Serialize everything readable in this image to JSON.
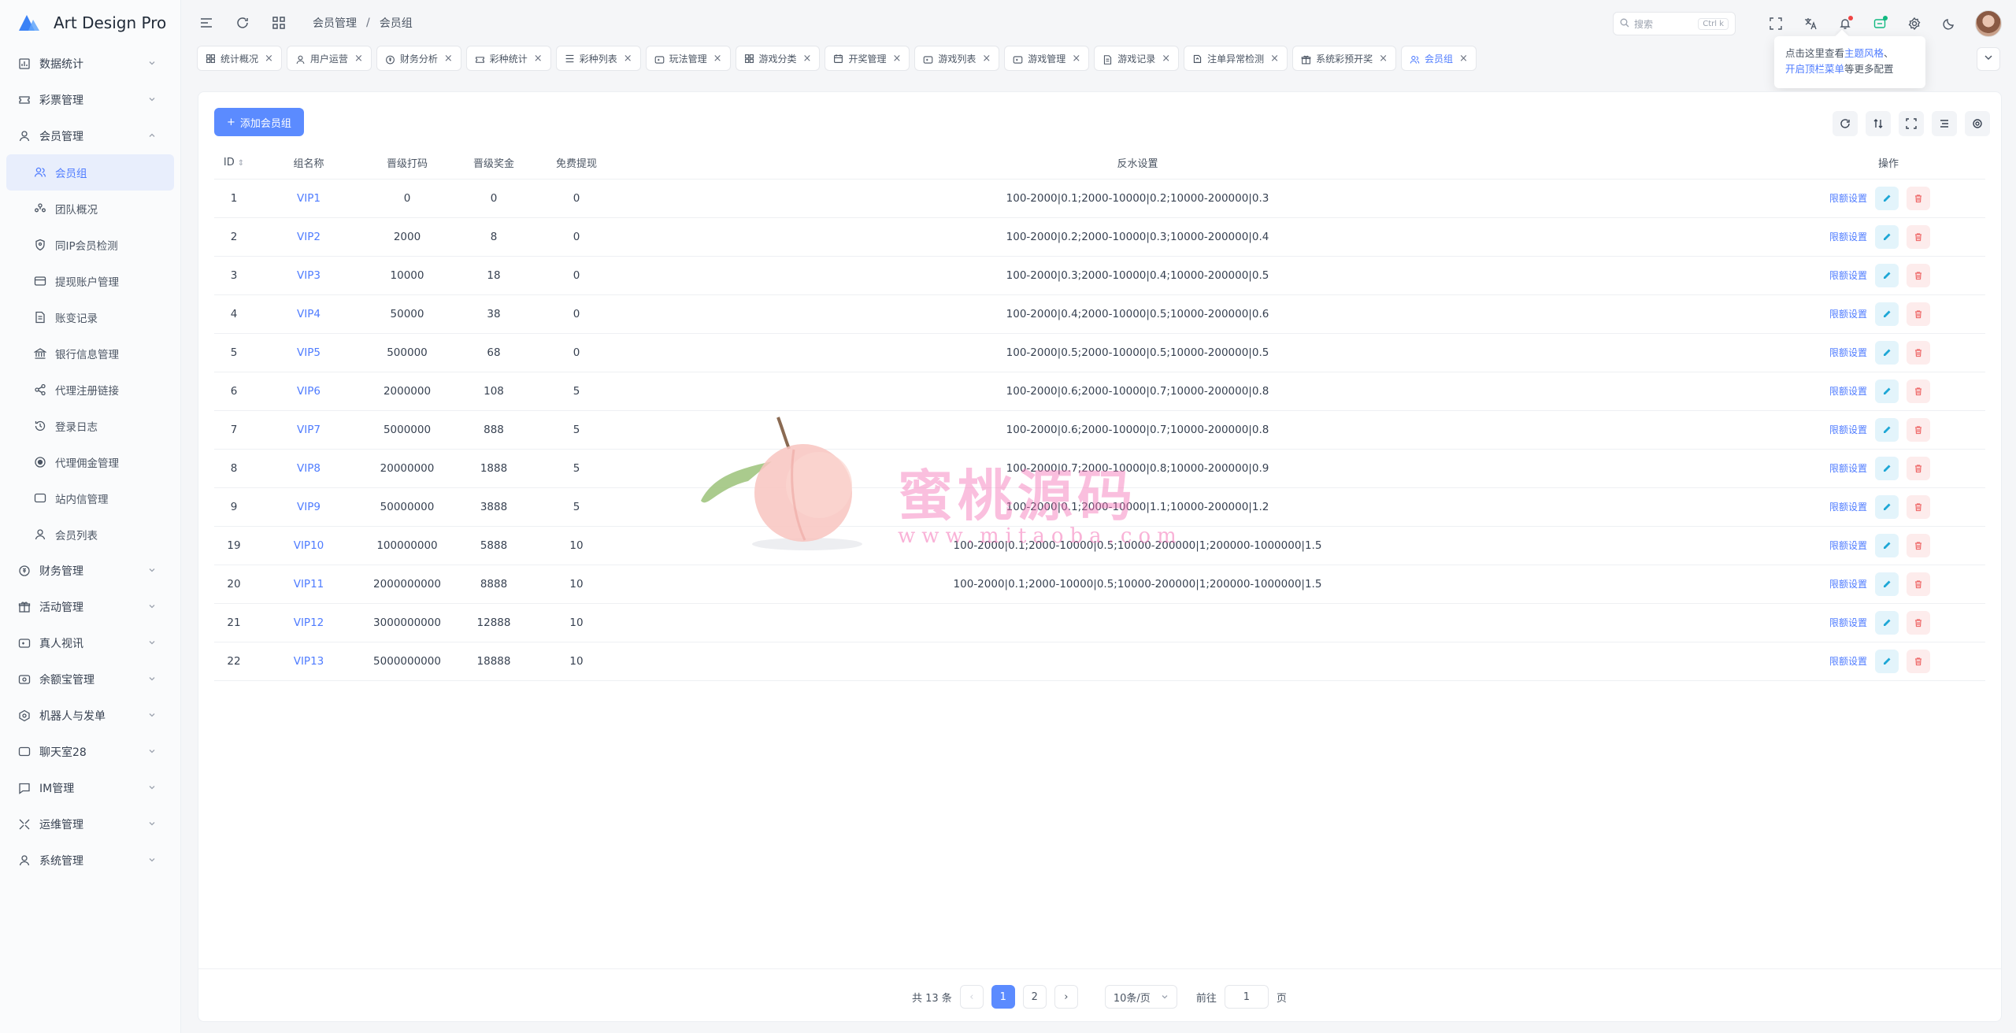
{
  "app": {
    "title": "Art Design Pro"
  },
  "sidebar": {
    "items": [
      {
        "label": "数据统计",
        "icon": "chart-icon"
      },
      {
        "label": "彩票管理",
        "icon": "ticket-icon"
      },
      {
        "label": "会员管理",
        "icon": "user-icon",
        "expanded": true,
        "children": [
          {
            "label": "会员组",
            "icon": "users-icon",
            "active": true
          },
          {
            "label": "团队概况",
            "icon": "team-icon"
          },
          {
            "label": "同IP会员检测",
            "icon": "shield-icon"
          },
          {
            "label": "提现账户管理",
            "icon": "card-icon"
          },
          {
            "label": "账变记录",
            "icon": "document-icon"
          },
          {
            "label": "银行信息管理",
            "icon": "bank-icon"
          },
          {
            "label": "代理注册链接",
            "icon": "share-icon"
          },
          {
            "label": "登录日志",
            "icon": "history-icon"
          },
          {
            "label": "代理佣金管理",
            "icon": "coin-icon"
          },
          {
            "label": "站内信管理",
            "icon": "message-icon"
          },
          {
            "label": "会员列表",
            "icon": "user-icon"
          }
        ]
      },
      {
        "label": "财务管理",
        "icon": "finance-icon"
      },
      {
        "label": "活动管理",
        "icon": "gift-icon"
      },
      {
        "label": "真人视讯",
        "icon": "video-icon"
      },
      {
        "label": "余额宝管理",
        "icon": "wallet-icon"
      },
      {
        "label": "机器人与发单",
        "icon": "robot-icon"
      },
      {
        "label": "聊天室28",
        "icon": "chat-icon"
      },
      {
        "label": "IM管理",
        "icon": "im-icon"
      },
      {
        "label": "运维管理",
        "icon": "tools-icon"
      },
      {
        "label": "系统管理",
        "icon": "user-icon"
      }
    ]
  },
  "topbar": {
    "breadcrumb": [
      "会员管理",
      "会员组"
    ],
    "breadcrumb_sep": "/",
    "search_placeholder": "搜索",
    "search_shortcut": "Ctrl k"
  },
  "tabs": [
    {
      "label": "统计概况",
      "icon": "grid-icon"
    },
    {
      "label": "用户运营",
      "icon": "user-icon"
    },
    {
      "label": "财务分析",
      "icon": "finance-icon"
    },
    {
      "label": "彩种统计",
      "icon": "ticket-icon"
    },
    {
      "label": "彩种列表",
      "icon": "list-icon"
    },
    {
      "label": "玩法管理",
      "icon": "video-icon"
    },
    {
      "label": "游戏分类",
      "icon": "grid-icon"
    },
    {
      "label": "开奖管理",
      "icon": "calendar-icon"
    },
    {
      "label": "游戏列表",
      "icon": "video-icon"
    },
    {
      "label": "游戏管理",
      "icon": "video-icon"
    },
    {
      "label": "游戏记录",
      "icon": "document-icon"
    },
    {
      "label": "注单异常检测",
      "icon": "alert-icon"
    },
    {
      "label": "系统彩预开奖",
      "icon": "gift-icon"
    },
    {
      "label": "会员组",
      "icon": "users-icon",
      "active": true
    }
  ],
  "tooltip": {
    "line1_prefix": "点击这里查看",
    "line1_link": "主题风格",
    "line1_suffix": "、",
    "line2_link": "开启顶栏菜单",
    "line2_suffix": "等更多配置"
  },
  "main": {
    "add_button": "添加会员组",
    "columns": [
      "ID",
      "组名称",
      "晋级打码",
      "晋级奖金",
      "免费提现",
      "反水设置",
      "操作"
    ],
    "op_link": "限额设置",
    "rows": [
      {
        "id": "1",
        "name": "VIP1",
        "bet": "0",
        "bonus": "0",
        "free": "0",
        "rebate": "100-2000|0.1;2000-10000|0.2;10000-200000|0.3"
      },
      {
        "id": "2",
        "name": "VIP2",
        "bet": "2000",
        "bonus": "8",
        "free": "0",
        "rebate": "100-2000|0.2;2000-10000|0.3;10000-200000|0.4"
      },
      {
        "id": "3",
        "name": "VIP3",
        "bet": "10000",
        "bonus": "18",
        "free": "0",
        "rebate": "100-2000|0.3;2000-10000|0.4;10000-200000|0.5"
      },
      {
        "id": "4",
        "name": "VIP4",
        "bet": "50000",
        "bonus": "38",
        "free": "0",
        "rebate": "100-2000|0.4;2000-10000|0.5;10000-200000|0.6"
      },
      {
        "id": "5",
        "name": "VIP5",
        "bet": "500000",
        "bonus": "68",
        "free": "0",
        "rebate": "100-2000|0.5;2000-10000|0.5;10000-200000|0.5"
      },
      {
        "id": "6",
        "name": "VIP6",
        "bet": "2000000",
        "bonus": "108",
        "free": "5",
        "rebate": "100-2000|0.6;2000-10000|0.7;10000-200000|0.8"
      },
      {
        "id": "7",
        "name": "VIP7",
        "bet": "5000000",
        "bonus": "888",
        "free": "5",
        "rebate": "100-2000|0.6;2000-10000|0.7;10000-200000|0.8"
      },
      {
        "id": "8",
        "name": "VIP8",
        "bet": "20000000",
        "bonus": "1888",
        "free": "5",
        "rebate": "100-2000|0.7;2000-10000|0.8;10000-200000|0.9"
      },
      {
        "id": "9",
        "name": "VIP9",
        "bet": "50000000",
        "bonus": "3888",
        "free": "5",
        "rebate": "100-2000|0.1;2000-10000|1.1;10000-200000|1.2"
      },
      {
        "id": "19",
        "name": "VIP10",
        "bet": "100000000",
        "bonus": "5888",
        "free": "10",
        "rebate": "100-2000|0.1;2000-10000|0.5;10000-200000|1;200000-1000000|1.5"
      },
      {
        "id": "20",
        "name": "VIP11",
        "bet": "2000000000",
        "bonus": "8888",
        "free": "10",
        "rebate": "100-2000|0.1;2000-10000|0.5;10000-200000|1;200000-1000000|1.5"
      },
      {
        "id": "21",
        "name": "VIP12",
        "bet": "3000000000",
        "bonus": "12888",
        "free": "10",
        "rebate": ""
      },
      {
        "id": "22",
        "name": "VIP13",
        "bet": "5000000000",
        "bonus": "18888",
        "free": "10",
        "rebate": ""
      }
    ]
  },
  "pagination": {
    "total": "共 13 条",
    "pages": [
      "1",
      "2"
    ],
    "current": "1",
    "page_size": "10条/页",
    "goto_label": "前往",
    "goto_value": "1",
    "goto_suffix": "页"
  },
  "watermark": {
    "title": "蜜桃源码",
    "url": "www.mitaoba.com"
  },
  "colors": {
    "accent": "#5b8bff",
    "edit": "#1ea7d6",
    "delete": "#ef6b6b"
  }
}
